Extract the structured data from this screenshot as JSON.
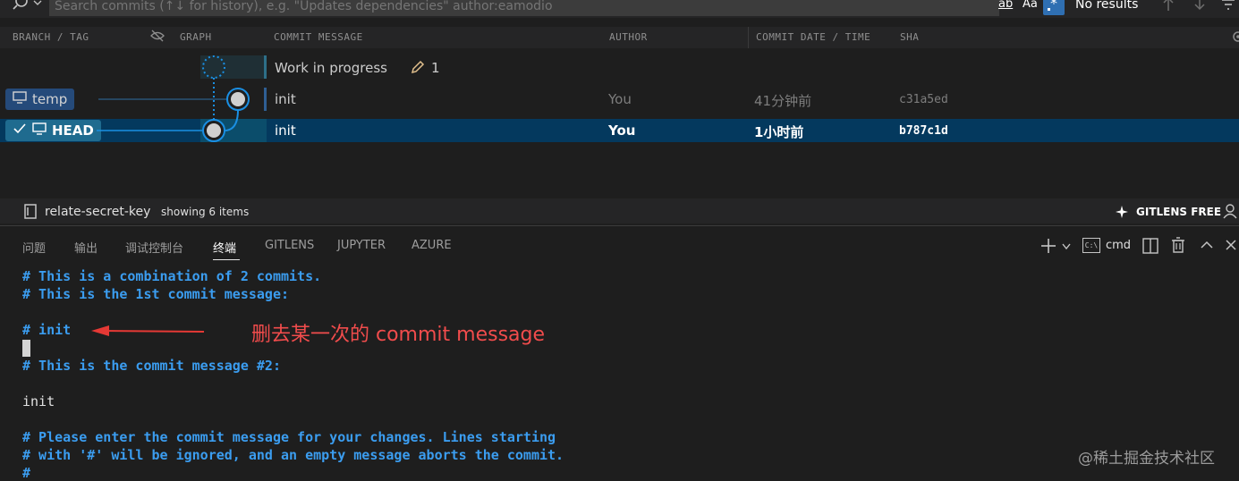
{
  "search": {
    "placeholder": "Search commits (↑↓ for history), e.g. \"Updates dependencies\" author:eamodio",
    "match_word_label": "ab",
    "match_case_label": "Aa",
    "results": "No results"
  },
  "graph_header": {
    "branch_tag": "BRANCH / TAG",
    "graph": "GRAPH",
    "commit_message": "COMMIT MESSAGE",
    "author": "AUTHOR",
    "commit_date_time": "COMMIT DATE / TIME",
    "sha": "SHA"
  },
  "rows": [
    {
      "branch": "",
      "message": "Work in progress",
      "wip_count": "1",
      "author": "",
      "date": "",
      "sha": ""
    },
    {
      "branch": "temp",
      "message": "init",
      "author": "You",
      "date": "41分钟前",
      "sha": "c31a5ed"
    },
    {
      "branch": "HEAD",
      "message": "init",
      "author": "You",
      "date": "1小时前",
      "sha": "b787c1d"
    }
  ],
  "gitlens_status": {
    "repo": "relate-secret-key",
    "showing": "showing 6 items",
    "badge": "GITLENS FREE"
  },
  "panel_tabs": [
    "问题",
    "输出",
    "调试控制台",
    "终端",
    "GITLENS",
    "JUPYTER",
    "AZURE"
  ],
  "panel_active_tab": "终端",
  "panel_toolbar": {
    "shell": "cmd",
    "cmd_icon_text": "C:\\"
  },
  "terminal_lines": [
    "# This is a combination of 2 commits.",
    "# This is the 1st commit message:",
    "",
    "# init",
    "",
    "# This is the commit message #2:",
    "",
    "init",
    "",
    "# Please enter the commit message for your changes. Lines starting",
    "# with '#' will be ignored, and an empty message aborts the commit.",
    "#"
  ],
  "annotation": "删去某一次的 commit message",
  "watermark": "@稀土掘金技术社区",
  "colors": {
    "selected_row": "#04395e",
    "terminal_comment": "#3b9df0",
    "annotation": "#f14c4c",
    "graph_line": "#1a8fe3"
  }
}
